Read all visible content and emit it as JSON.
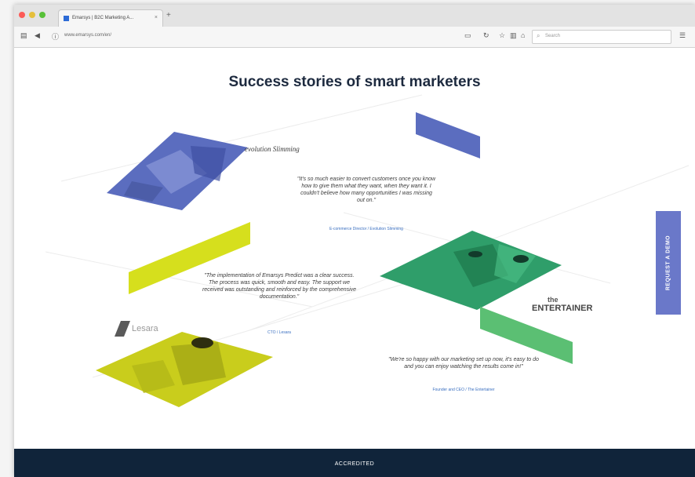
{
  "browser": {
    "tab_title": "Emarsys | B2C Marketing A...",
    "tab_close": "×",
    "new_tab": "+",
    "url": "www.emarsys.com/en/",
    "search_placeholder": "Search",
    "traffic_light_colors": [
      "#fc5b57",
      "#e5bf3c",
      "#57c038"
    ]
  },
  "page": {
    "heading": "Success stories of smart marketers",
    "request_demo_label": "REQUEST A DEMO",
    "footer_label": "ACCREDITED",
    "brand_colors": {
      "blue": "#5b6dbf",
      "lime": "#d6df1d",
      "green": "#2f9e6a",
      "navy": "#10243a"
    }
  },
  "stories": [
    {
      "logo": "evolution Slimming",
      "quote": "\"It's so much easier to convert customers once you know how to give them what they want, when they want it. I couldn't believe how many opportunities I was missing out on.\"",
      "attribution": "E-commerce Director / Evolution Slimming"
    },
    {
      "logo": "Lesara",
      "quote": "\"The implementation of Emarsys Predict was a clear success. The process was quick, smooth and easy. The support we received was outstanding and reinforced by the comprehensive documentation.\"",
      "attribution": "CTO / Lesara"
    },
    {
      "logo_top": "the",
      "logo": "ENTERTAINER",
      "quote": "\"We're so happy with our marketing set up now, it's easy to do and you can enjoy watching the results come in!\"",
      "attribution": "Founder and CEO / The Entertainer"
    }
  ]
}
